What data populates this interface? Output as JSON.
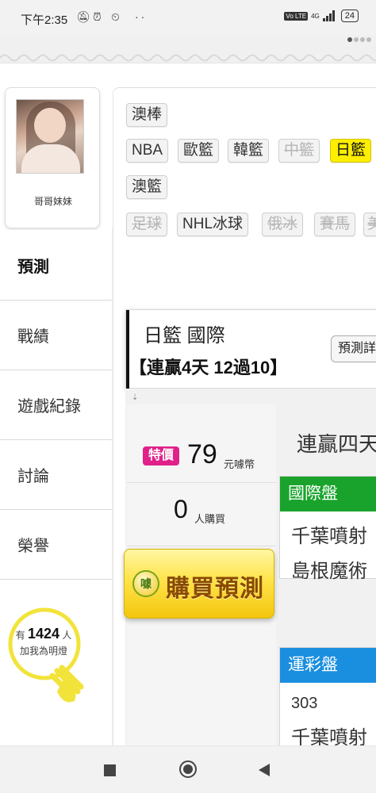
{
  "status_bar": {
    "time": "下午2:35",
    "network": "4G",
    "volte": "Vo LTE",
    "battery": "24"
  },
  "profile": {
    "name": "哥哥妹妹"
  },
  "sidebar": {
    "items": [
      {
        "label": "預測",
        "active": true
      },
      {
        "label": "戰績"
      },
      {
        "label": "遊戲紀錄"
      },
      {
        "label": "討論"
      },
      {
        "label": "榮譽"
      }
    ],
    "fans": {
      "prefix": "有",
      "count": "1424",
      "suffix": "人",
      "caption": "加我為明燈"
    }
  },
  "categories": {
    "rows": [
      [
        {
          "label": "澳棒",
          "state": "normal"
        }
      ],
      [
        {
          "label": "NBA",
          "state": "normal"
        },
        {
          "label": "歐籃",
          "state": "normal"
        },
        {
          "label": "韓籃",
          "state": "normal"
        },
        {
          "label": "中籃",
          "state": "disabled"
        },
        {
          "label": "日籃",
          "state": "selected"
        }
      ],
      [
        {
          "label": "澳籃",
          "state": "normal"
        }
      ],
      [
        {
          "label": "足球",
          "state": "disabled"
        },
        {
          "label": "NHL冰球",
          "state": "normal"
        },
        {
          "label": "俄冰",
          "state": "disabled"
        },
        {
          "label": "賽馬",
          "state": "disabled"
        },
        {
          "label": "美",
          "state": "disabled"
        }
      ]
    ]
  },
  "prediction": {
    "title": "日籃 國際",
    "streak": "【連贏4天 12過10】",
    "detail_button": "預測詳",
    "special_badge": "特價",
    "price": "79",
    "price_unit": "元噱幣",
    "buyers": "0",
    "buyers_unit": "人購買",
    "buy_button": "購買預測",
    "coin_icon_text": "噱",
    "streak_label": "連贏四天",
    "cards": [
      {
        "header": "國際盤",
        "color": "#1aa32c",
        "lines": [
          "千葉噴射",
          "島根魔術"
        ]
      },
      {
        "header": "運彩盤",
        "color": "#1a8fe0",
        "lines": [
          "303",
          "千葉噴射"
        ]
      }
    ]
  }
}
